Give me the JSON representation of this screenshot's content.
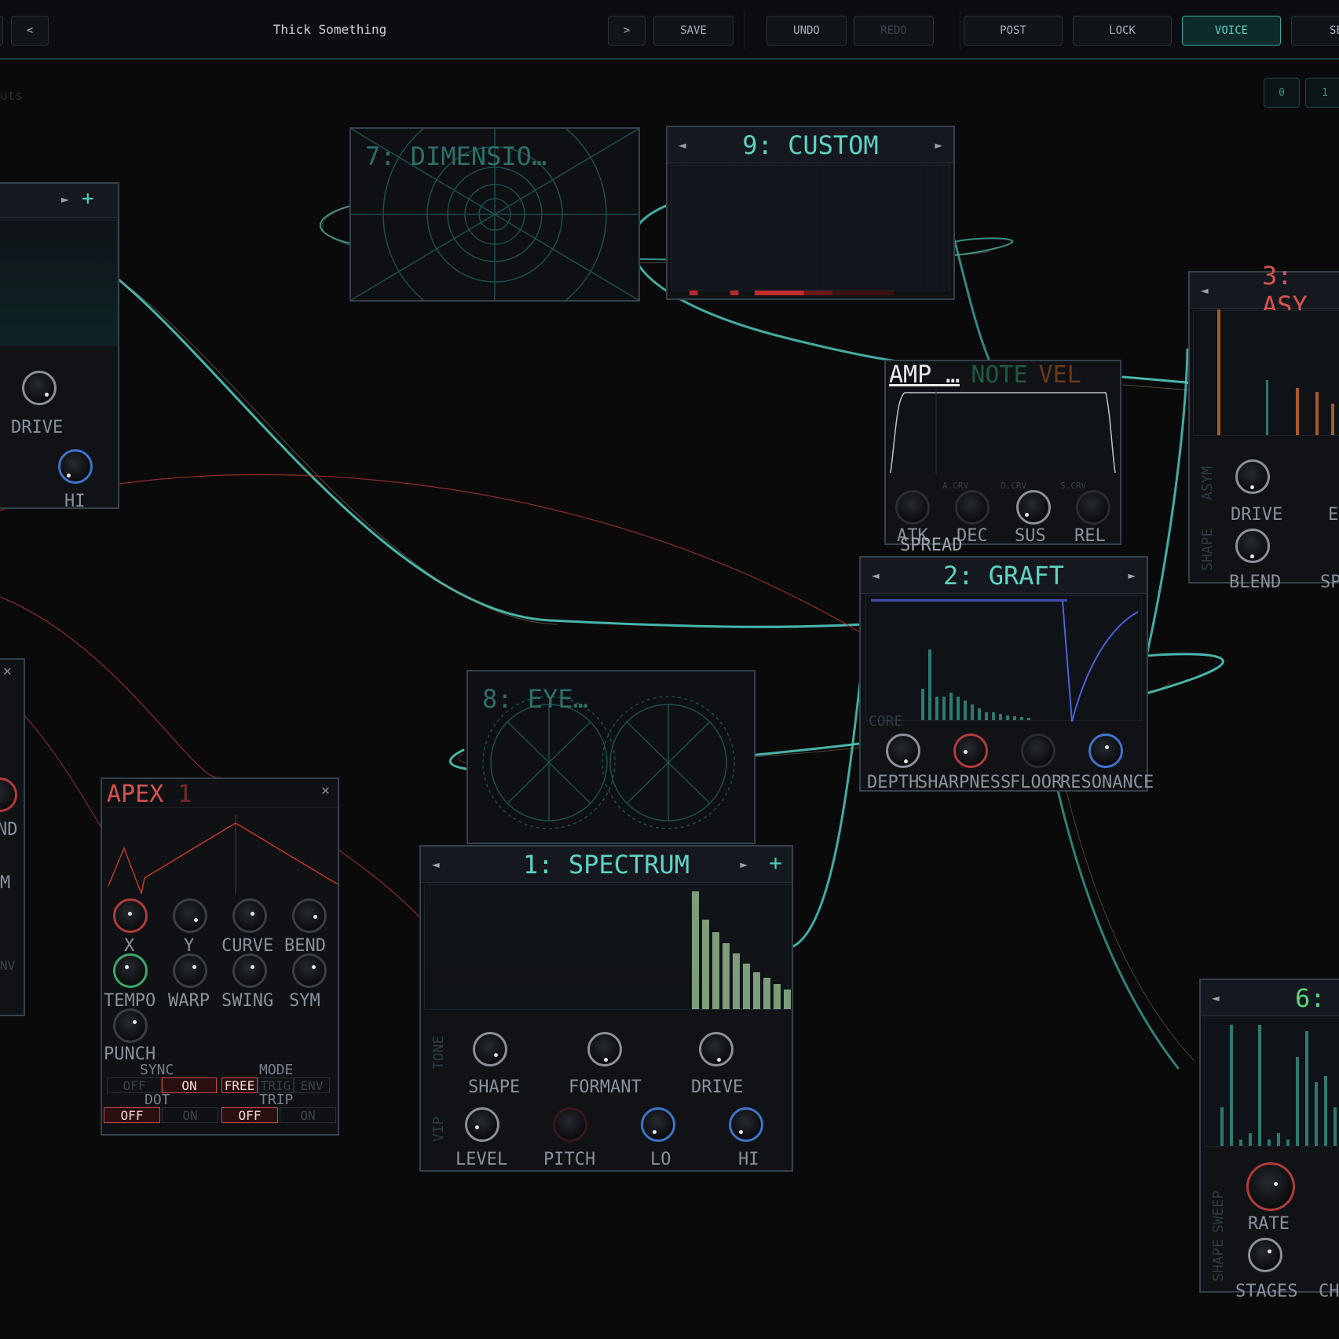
{
  "toolbar": {
    "prev_label": "<",
    "title": "Thick Something",
    "next_label": ">",
    "save_label": "SAVE",
    "undo_label": "UNDO",
    "redo_label": "REDO",
    "post_label": "POST",
    "lock_label": "LOCK",
    "voice_label": "VOICE",
    "cut_label": "SE"
  },
  "canvas": {
    "outputs_label": "uts",
    "page_buttons": [
      "0",
      "1"
    ]
  },
  "modules": {
    "left_top": {
      "drive": "DRIVE",
      "hi": "HI",
      "next": "►",
      "add": "+"
    },
    "dimension": {
      "title": "7: DIMENSIO…"
    },
    "custom": {
      "title": "9: CUSTOM",
      "prev": "◄",
      "next": "►"
    },
    "asym": {
      "title": "3: ASY",
      "prev": "◄",
      "side1": "ASYM",
      "side2": "SHAPE",
      "drive": "DRIVE",
      "e": "E",
      "blend": "BLEND",
      "sp": "SP"
    },
    "envelope": {
      "tab_amp": "AMP …",
      "tab_note": "NOTE",
      "tab_vel": "VEL",
      "a_crv": "A.CRV",
      "d_crv": "D.CRV",
      "s_crv": "S.CRV",
      "atk": "ATK",
      "dec": "DEC",
      "sus": "SUS",
      "rel": "REL",
      "spread": "SPREAD"
    },
    "graft": {
      "title": "2: GRAFT",
      "prev": "◄",
      "next": "►",
      "core": "CORE",
      "depth": "DEPTH",
      "sharpness": "SHARPNESS",
      "floor": "FLOOR",
      "resonance": "RESONANCE"
    },
    "eye": {
      "title": "8: EYE…"
    },
    "left_mid": {
      "close": "✕",
      "nd": "ND",
      "m": "M",
      "nv": "NV"
    },
    "apex": {
      "title": "APEX",
      "num": "1",
      "close": "✕",
      "x": "X",
      "y": "Y",
      "curve": "CURVE",
      "bend": "BEND",
      "tempo": "TEMPO",
      "warp": "WARP",
      "swing": "SWING",
      "sym": "SYM",
      "punch": "PUNCH",
      "sync": "SYNC",
      "mode": "MODE",
      "sync_off": "OFF",
      "sync_on": "ON",
      "mode_free": "FREE",
      "mode_trig": "TRIG",
      "mode_env": "ENV",
      "dot": "DOT",
      "trip": "TRIP",
      "dot_off": "OFF",
      "dot_on": "ON",
      "trip_off": "OFF",
      "trip_on": "ON"
    },
    "spectrum": {
      "title": "1: SPECTRUM",
      "prev": "◄",
      "next": "►",
      "add": "+",
      "tone": "TONE",
      "vip": "VIP",
      "shape": "SHAPE",
      "formant": "FORMANT",
      "drive": "DRIVE",
      "level": "LEVEL",
      "pitch": "PITCH",
      "lo": "LO",
      "hi": "HI"
    },
    "sweep": {
      "title": "6:",
      "prev": "◄",
      "side1": "SWEEP",
      "side2": "SHAPE",
      "rate": "RATE",
      "stages": "STAGES",
      "ch": "CH"
    }
  },
  "colors": {
    "accent": "#5fd3c5",
    "red": "#d9534f",
    "cable": "#4fc9bd",
    "bg": "#0a0a0b"
  },
  "spectrum_bars": [
    0.95,
    0.72,
    0.62,
    0.53,
    0.45,
    0.37,
    0.3,
    0.25,
    0.2,
    0.16
  ],
  "graft_bars": [
    0.4,
    0.9,
    0.3,
    0.3,
    0.35,
    0.3,
    0.25,
    0.2,
    0.15,
    0.1,
    0.1,
    0.08,
    0.06,
    0.05,
    0.04,
    0.03
  ],
  "sweep_bars": [
    0.3,
    0.95,
    0.05,
    0.1,
    0.95,
    0.05,
    0.1,
    0.05,
    0.7,
    0.9,
    0.5,
    0.55,
    0.3
  ]
}
